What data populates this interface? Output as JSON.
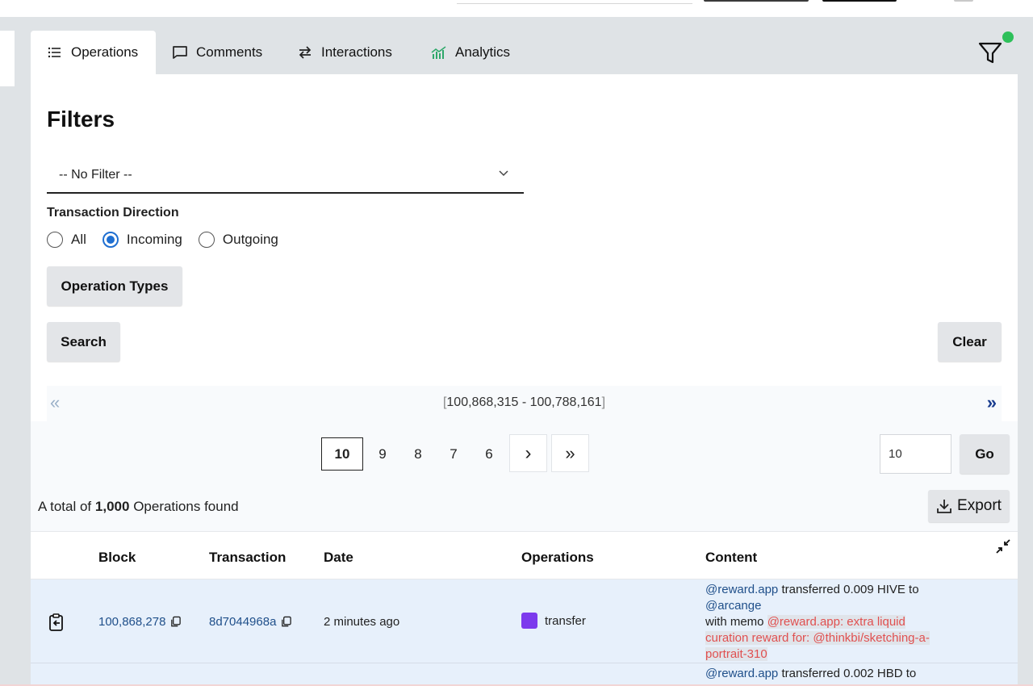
{
  "tabs": [
    {
      "label": "Operations",
      "icon": "list-icon"
    },
    {
      "label": "Comments",
      "icon": "comment-icon"
    },
    {
      "label": "Interactions",
      "icon": "arrows-exchange-icon"
    },
    {
      "label": "Analytics",
      "icon": "bar-chart-icon"
    }
  ],
  "active_tab": "Operations",
  "filter_indicator_color": "#2ec05a",
  "filters": {
    "title": "Filters",
    "select_value": "-- No Filter --",
    "direction_label": "Transaction Direction",
    "direction_options": [
      "All",
      "Incoming",
      "Outgoing"
    ],
    "direction_selected": "Incoming",
    "operation_types_label": "Operation Types",
    "search_label": "Search",
    "clear_label": "Clear"
  },
  "range": {
    "text": "100,868,315 - 100,788,161",
    "open": "[",
    "close": "]",
    "prev_symbol": "«",
    "next_symbol": "»"
  },
  "pagination": {
    "pages": [
      "10",
      "9",
      "8",
      "7",
      "6"
    ],
    "current": "10",
    "next_symbol": "›",
    "last_symbol": "»",
    "page_input_value": "10",
    "go_label": "Go"
  },
  "total": {
    "prefix": "A total of",
    "count": "1,000",
    "suffix": "Operations found",
    "export_label": "Export"
  },
  "table": {
    "headers": [
      "Block",
      "Transaction",
      "Date",
      "Operations",
      "Content"
    ],
    "rows": [
      {
        "block": "100,868,278",
        "transaction": "8d7044968a",
        "date": "2 minutes ago",
        "operation": "transfer",
        "operation_color": "#7c3aed",
        "content": {
          "from": "@reward.app",
          "action": "transferred 0.009 HIVE to",
          "to": "@arcange",
          "memo_label": "with memo",
          "memo": "@reward.app: extra liquid curation reward for: @thinkbi/sketching-a-portrait-310"
        }
      },
      {
        "content": {
          "from": "@reward.app",
          "action": "transferred 0.002 HBD to"
        }
      }
    ]
  }
}
